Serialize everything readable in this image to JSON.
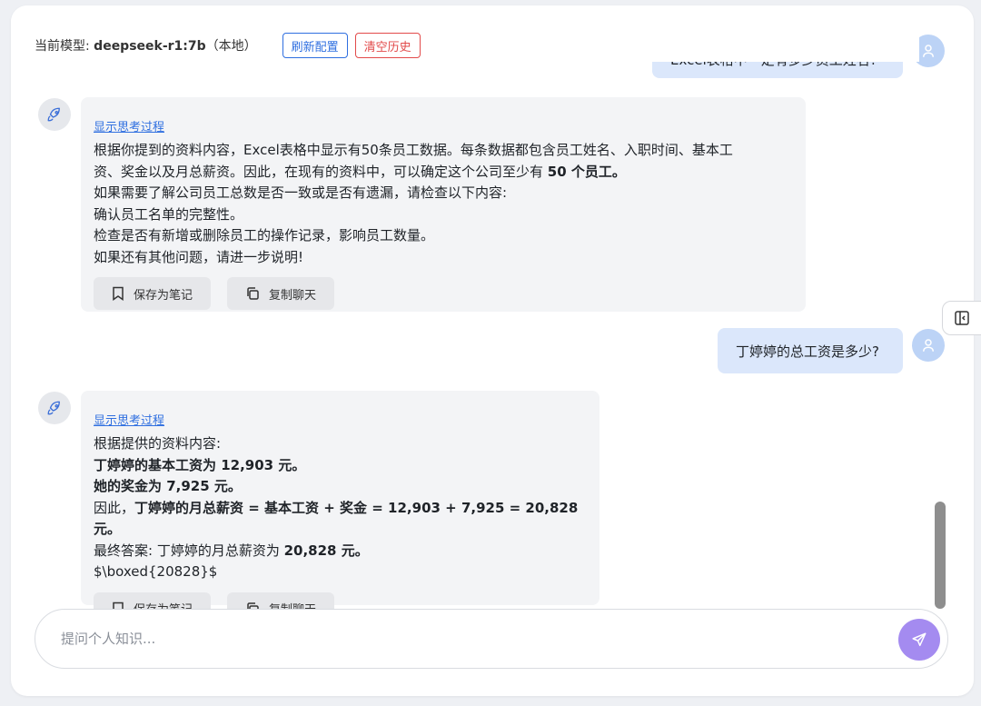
{
  "header": {
    "model_prefix": "当前模型: ",
    "model_name": "deepseek-r1:7b",
    "model_suffix": "（本地）",
    "refresh_label": "刷新配置",
    "clear_label": "清空历史"
  },
  "messages": [
    {
      "role": "user",
      "text": "Excel表格中一定有多少员工姓名?"
    },
    {
      "role": "assistant",
      "think_label": "显示思考过程",
      "lines": [
        [
          {
            "t": "根据你提到的资料内容，Excel表格中显示有50条员工数据。每条数据都包含员工姓名、入职时间、基本工"
          }
        ],
        [
          {
            "t": "资、奖金以及月总薪资。因此，在现有的资料中，可以确定这个公司至少有 "
          },
          {
            "t": "50 个员工。",
            "b": true
          }
        ],
        [
          {
            "t": "如果需要了解公司员工总数是否一致或是否有遗漏，请检查以下内容:"
          }
        ],
        [
          {
            "t": "确认员工名单的完整性。"
          }
        ],
        [
          {
            "t": "检查是否有新增或删除员工的操作记录，影响员工数量。"
          }
        ],
        [
          {
            "t": "如果还有其他问题，请进一步说明!"
          }
        ]
      ],
      "save_label": "保存为笔记",
      "copy_label": "复制聊天"
    },
    {
      "role": "user",
      "text": "丁婷婷的总工资是多少?"
    },
    {
      "role": "assistant",
      "think_label": "显示思考过程",
      "lines": [
        [
          {
            "t": "根据提供的资料内容:"
          }
        ],
        [
          {
            "t": "丁婷婷的基本工资为 12,903 元。",
            "b": true
          }
        ],
        [
          {
            "t": "她的奖金为 7,925 元。",
            "b": true
          }
        ],
        [
          {
            "t": "因此，"
          },
          {
            "t": "丁婷婷的月总薪资 = 基本工资 + 奖金 = 12,903 + 7,925 = 20,828 元。",
            "b": true
          }
        ],
        [
          {
            "t": "最终答案: 丁婷婷的月总薪资为 "
          },
          {
            "t": "20,828 元。",
            "b": true
          }
        ],
        [
          {
            "t": "$\\boxed{20828}$"
          }
        ]
      ],
      "save_label": "保存为笔记",
      "copy_label": "复制聊天"
    }
  ],
  "composer": {
    "placeholder": "提问个人知识...",
    "value": ""
  },
  "icons": {
    "bot_avatar": "rocket-icon",
    "user_avatar": "user-icon",
    "save": "bookmark-icon",
    "copy": "copy-icon",
    "send": "send-icon",
    "side_toggle": "panel-toggle-icon"
  },
  "colors": {
    "accent_blue": "#2f6fe0",
    "danger_red": "#e24a4a",
    "user_bubble": "#dbe7fb",
    "bot_bubble": "#f3f4f6",
    "send_button": "#a48bf0"
  }
}
